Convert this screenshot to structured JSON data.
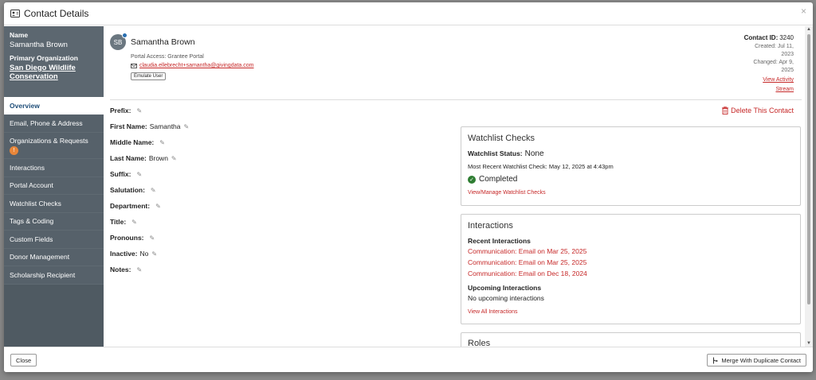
{
  "modal": {
    "title": "Contact Details",
    "close_symbol": "×"
  },
  "sidebar": {
    "name_label": "Name",
    "name_value": "Samantha Brown",
    "org_label": "Primary Organization",
    "org_value": "San Diego Wildlife Conservation",
    "items": [
      {
        "label": "Overview",
        "active": true
      },
      {
        "label": "Email, Phone & Address"
      },
      {
        "label": "Organizations & Requests",
        "badge": "!"
      },
      {
        "label": "Interactions"
      },
      {
        "label": "Portal Account"
      },
      {
        "label": "Watchlist Checks"
      },
      {
        "label": "Tags & Coding"
      },
      {
        "label": "Custom Fields"
      },
      {
        "label": "Donor Management"
      },
      {
        "label": "Scholarship Recipient"
      }
    ]
  },
  "profile": {
    "initials": "SB",
    "name": "Samantha Brown",
    "portal_access": "Portal Access: Grantee Portal",
    "email": "claudia.ellebrecht+samantha@givingdata.com",
    "emulate_label": "Emulate User"
  },
  "meta": {
    "contact_id_label": "Contact ID:",
    "contact_id_value": "3240",
    "created_line1": "Created: Jul 11,",
    "created_line2": "2023",
    "changed_line1": "Changed: Apr 9,",
    "changed_line2": "2025",
    "activity_line1": "View Activity",
    "activity_line2": "Stream"
  },
  "fields": [
    {
      "label": "Prefix:",
      "value": ""
    },
    {
      "label": "First Name:",
      "value": "Samantha"
    },
    {
      "label": "Middle Name:",
      "value": ""
    },
    {
      "label": "Last Name:",
      "value": "Brown"
    },
    {
      "label": "Suffix:",
      "value": ""
    },
    {
      "label": "Salutation:",
      "value": ""
    },
    {
      "label": "Department:",
      "value": ""
    },
    {
      "label": "Title:",
      "value": ""
    },
    {
      "label": "Pronouns:",
      "value": ""
    },
    {
      "label": "Inactive:",
      "value": "No"
    },
    {
      "label": "Notes:",
      "value": ""
    }
  ],
  "delete_label": "Delete This Contact",
  "watchlist": {
    "title": "Watchlist Checks",
    "status_label": "Watchlist Status:",
    "status_value": "None",
    "recent_check": "Most Recent Watchlist Check: May 12, 2025 at 4:43pm",
    "completed": "Completed",
    "manage_link": "View/Manage Watchlist Checks"
  },
  "interactions": {
    "title": "Interactions",
    "recent_label": "Recent Interactions",
    "recent": [
      "Communication: Email on Mar 25, 2025",
      "Communication: Email on Mar 25, 2025",
      "Communication: Email on Dec 18, 2024"
    ],
    "upcoming_label": "Upcoming Interactions",
    "upcoming_value": "No upcoming interactions",
    "view_all": "View All Interactions"
  },
  "roles": {
    "title": "Roles"
  },
  "footer": {
    "close_label": "Close",
    "merge_label": "Merge With Duplicate Contact"
  },
  "colors": {
    "accent_red": "#c62828",
    "sidebar_bg": "#4f5a62",
    "active_text": "#1f4e79",
    "badge": "#e8863a",
    "success": "#2e7d32"
  }
}
